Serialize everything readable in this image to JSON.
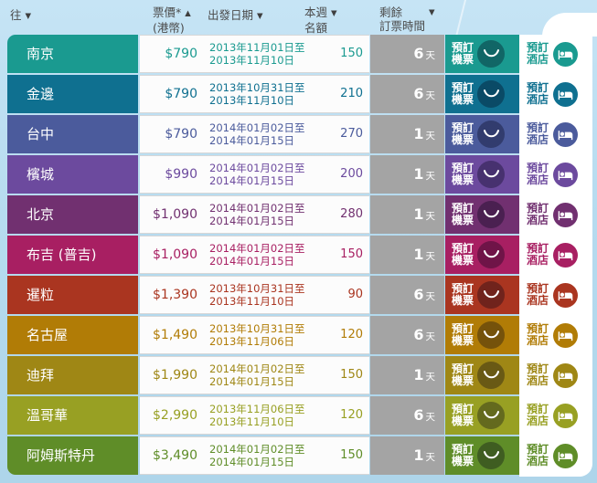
{
  "header": {
    "to": {
      "label": "往",
      "sort": "▼"
    },
    "fare": {
      "label": "票價*",
      "sort": "▲",
      "sub": "(港幣)"
    },
    "depart": {
      "label": "出發日期",
      "sort": "▼"
    },
    "quota": {
      "line1": "本週",
      "line2": "名額",
      "sort": "▼"
    },
    "remaining": {
      "line1": "剩餘",
      "line2": "訂票時間",
      "sort": "▼"
    }
  },
  "buttons": {
    "flight_line1": "預訂",
    "flight_line2": "機票",
    "hotel_line1": "預訂",
    "hotel_line2": "酒店"
  },
  "labels": {
    "day_unit": "天"
  },
  "colors": {
    "remaining_box": "#a4a4a4",
    "background_sky": "#b6dbef",
    "panel_white": "#ffffff"
  },
  "rows": [
    {
      "destination": "南京",
      "price": "$790",
      "date1": "2013年11月01日至",
      "date2": "2013年11月10日",
      "quota": "150",
      "days": "6",
      "color": "#1a9a90"
    },
    {
      "destination": "金邊",
      "price": "$790",
      "date1": "2013年10月31日至",
      "date2": "2013年11月10日",
      "quota": "210",
      "days": "6",
      "color": "#0f7090"
    },
    {
      "destination": "台中",
      "price": "$790",
      "date1": "2014年01月02日至",
      "date2": "2014年01月15日",
      "quota": "270",
      "days": "1",
      "color": "#4b5b9c"
    },
    {
      "destination": "檳城",
      "price": "$990",
      "date1": "2014年01月02日至",
      "date2": "2014年01月15日",
      "quota": "200",
      "days": "1",
      "color": "#6c4a9e"
    },
    {
      "destination": "北京",
      "price": "$1,090",
      "date1": "2014年01月02日至",
      "date2": "2014年01月15日",
      "quota": "280",
      "days": "1",
      "color": "#713070"
    },
    {
      "destination": "布吉 (普吉)",
      "price": "$1,090",
      "date1": "2014年01月02日至",
      "date2": "2014年01月15日",
      "quota": "150",
      "days": "1",
      "color": "#a81f62"
    },
    {
      "destination": "暹粒",
      "price": "$1,390",
      "date1": "2013年10月31日至",
      "date2": "2013年11月10日",
      "quota": "90",
      "days": "6",
      "color": "#aa3520"
    },
    {
      "destination": "名古屋",
      "price": "$1,490",
      "date1": "2013年10月31日至",
      "date2": "2013年11月06日",
      "quota": "120",
      "days": "6",
      "color": "#b17c06"
    },
    {
      "destination": "迪拜",
      "price": "$1,990",
      "date1": "2014年01月02日至",
      "date2": "2014年01月15日",
      "quota": "150",
      "days": "1",
      "color": "#9f8715"
    },
    {
      "destination": "溫哥華",
      "price": "$2,990",
      "date1": "2013年11月06日至",
      "date2": "2013年11月10日",
      "quota": "120",
      "days": "6",
      "color": "#98a023"
    },
    {
      "destination": "阿姆斯特丹",
      "price": "$3,490",
      "date1": "2014年01月02日至",
      "date2": "2014年01月15日",
      "quota": "150",
      "days": "1",
      "color": "#5f8d28"
    }
  ]
}
